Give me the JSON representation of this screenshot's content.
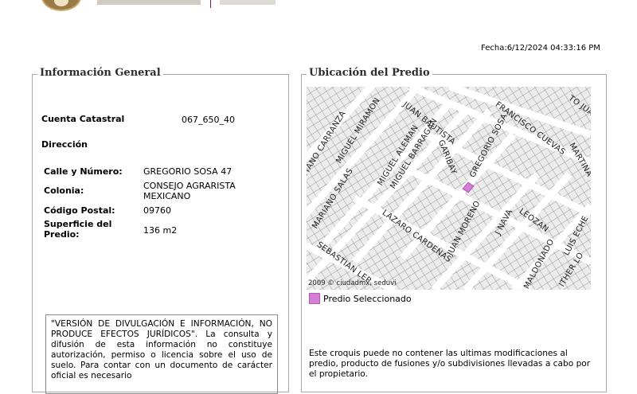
{
  "header": {
    "date": "Fecha:6/12/2024 04:33:16 PM"
  },
  "info": {
    "legend": "Información General",
    "rows": [
      {
        "label": "Cuenta Catastral",
        "value": "067_650_40"
      },
      {
        "label": "Dirección",
        "value": ""
      },
      {
        "label": "Calle y Número:",
        "value": "GREGORIO SOSA 47"
      },
      {
        "label": "Colonia:",
        "value": "CONSEJO AGRARISTA MEXICANO"
      },
      {
        "label": "Código Postal:",
        "value": "09760"
      },
      {
        "label": "Superficie del Predio:",
        "value": "136 m2"
      }
    ],
    "notice": "\"VERSIÓN DE DIVULGACIÓN E INFORMACIÓN, NO PRODUCE EFECTOS JURÍDICOS\". La consulta y difusión de esta información no constituye autorización, permiso o licencia sobre el uso de suelo. Para contar con un documento de carácter oficial es necesario"
  },
  "location": {
    "legend": "Ubicación del Predio",
    "map": {
      "streets": [
        "STANO CARRANZA",
        "MIGUEL MIRAMON",
        "JUAN BAUTISTA",
        "FRANCISCO CUEVAS",
        "TO JUA",
        "MIGUEL ALEMAN",
        "MIGUEL BARRAGAN",
        "GARIBAY",
        "GREGORIO SOSA",
        "MARTINA",
        "MARIANO SALAS",
        "LAZARO CARDENAS",
        "JUAN MORENO",
        "J NAVA",
        "LEOZAN",
        "LUIS ECHE",
        "SEBASTIAN LEP",
        "MALDONADO",
        "ITHER LO"
      ],
      "copyright": "2009 © ciudadmx, seduvi",
      "selected_color": "#d37fd6"
    },
    "legend_item": "Predio Seleccionado",
    "note": "Este croquis puede no contener las ultimas modificaciones al predio, producto de fusiones y/o subdivisiones llevadas a cabo por el propietario."
  }
}
